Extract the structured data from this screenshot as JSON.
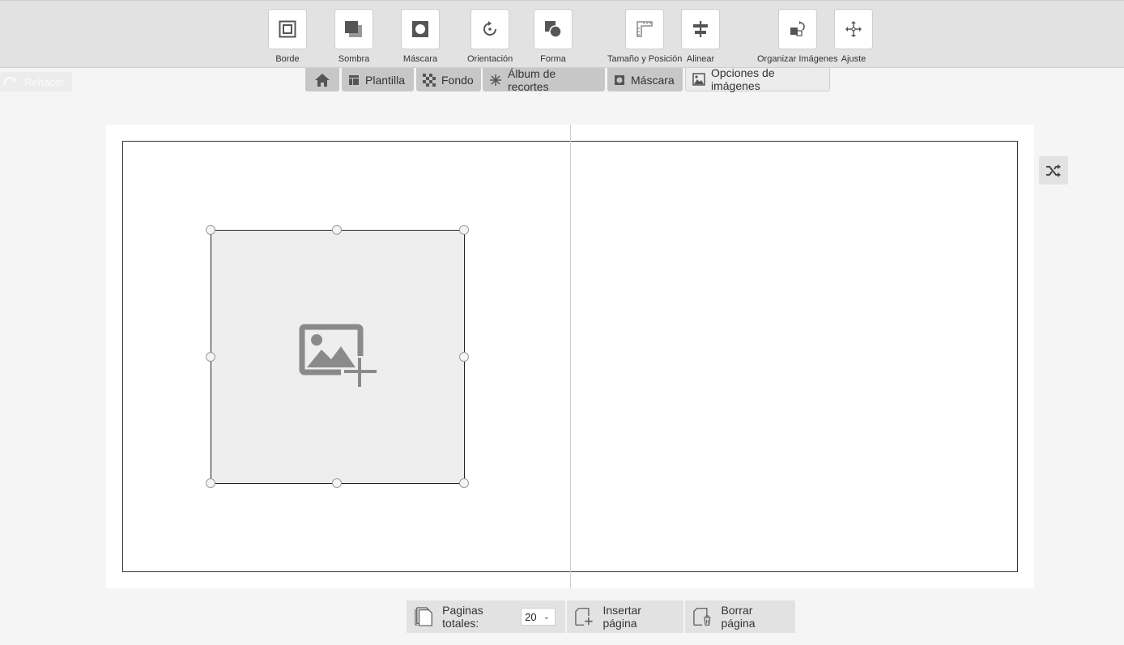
{
  "toolbar": {
    "tools": [
      {
        "label": "Borde",
        "icon": "border-icon"
      },
      {
        "label": "Sombra",
        "icon": "shadow-icon"
      },
      {
        "label": "Máscara",
        "icon": "mask-icon"
      },
      {
        "label": "Orientación",
        "icon": "rotate-icon"
      },
      {
        "label": "Forma",
        "icon": "shape-icon"
      },
      {
        "label": "Tamaño y Posición",
        "icon": "ruler-icon"
      },
      {
        "label": "Alinear",
        "icon": "align-icon"
      },
      {
        "label": "Organizar Imágenes",
        "icon": "arrange-icon"
      },
      {
        "label": "Ajuste",
        "icon": "move-icon"
      }
    ]
  },
  "redo": {
    "label": "Rehacer"
  },
  "tabs": [
    {
      "label": "",
      "icon": "home-icon"
    },
    {
      "label": "Plantilla",
      "icon": "template-icon"
    },
    {
      "label": "Fondo",
      "icon": "background-icon"
    },
    {
      "label": "Álbum de recortes",
      "icon": "sparkle-icon"
    },
    {
      "label": "Máscara",
      "icon": "mask-icon"
    },
    {
      "label": "Opciones de imágenes",
      "icon": "image-icon",
      "active": true
    }
  ],
  "bottom": {
    "total_pages_label": "Paginas totales:",
    "total_pages_value": "20",
    "insert_label": "Insertar página",
    "delete_label": "Borrar página"
  }
}
